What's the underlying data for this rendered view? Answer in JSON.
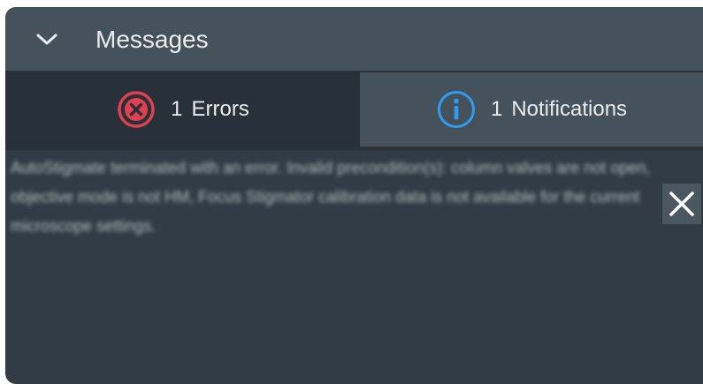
{
  "messages_panel": {
    "title": "Messages",
    "collapse_icon": "chevron-down-icon",
    "tabs": [
      {
        "count": "1",
        "label": "Errors",
        "icon": "error-circle-icon",
        "active": false
      },
      {
        "count": "1",
        "label": "Notifications",
        "icon": "info-circle-icon",
        "active": true
      }
    ],
    "message": {
      "text": "AutoStigmate terminated with an error. Invalid precondition(s): column valves are not open, objective mode is not HM, Focus Stigmator calibration data is not available for the current microscope settings.",
      "close_icon": "close-icon"
    },
    "colors": {
      "panel_bg": "#323c44",
      "header_bg": "#45525c",
      "error_red": "#e0404f",
      "info_blue": "#2e9cf0",
      "text": "#e8ecef"
    }
  }
}
